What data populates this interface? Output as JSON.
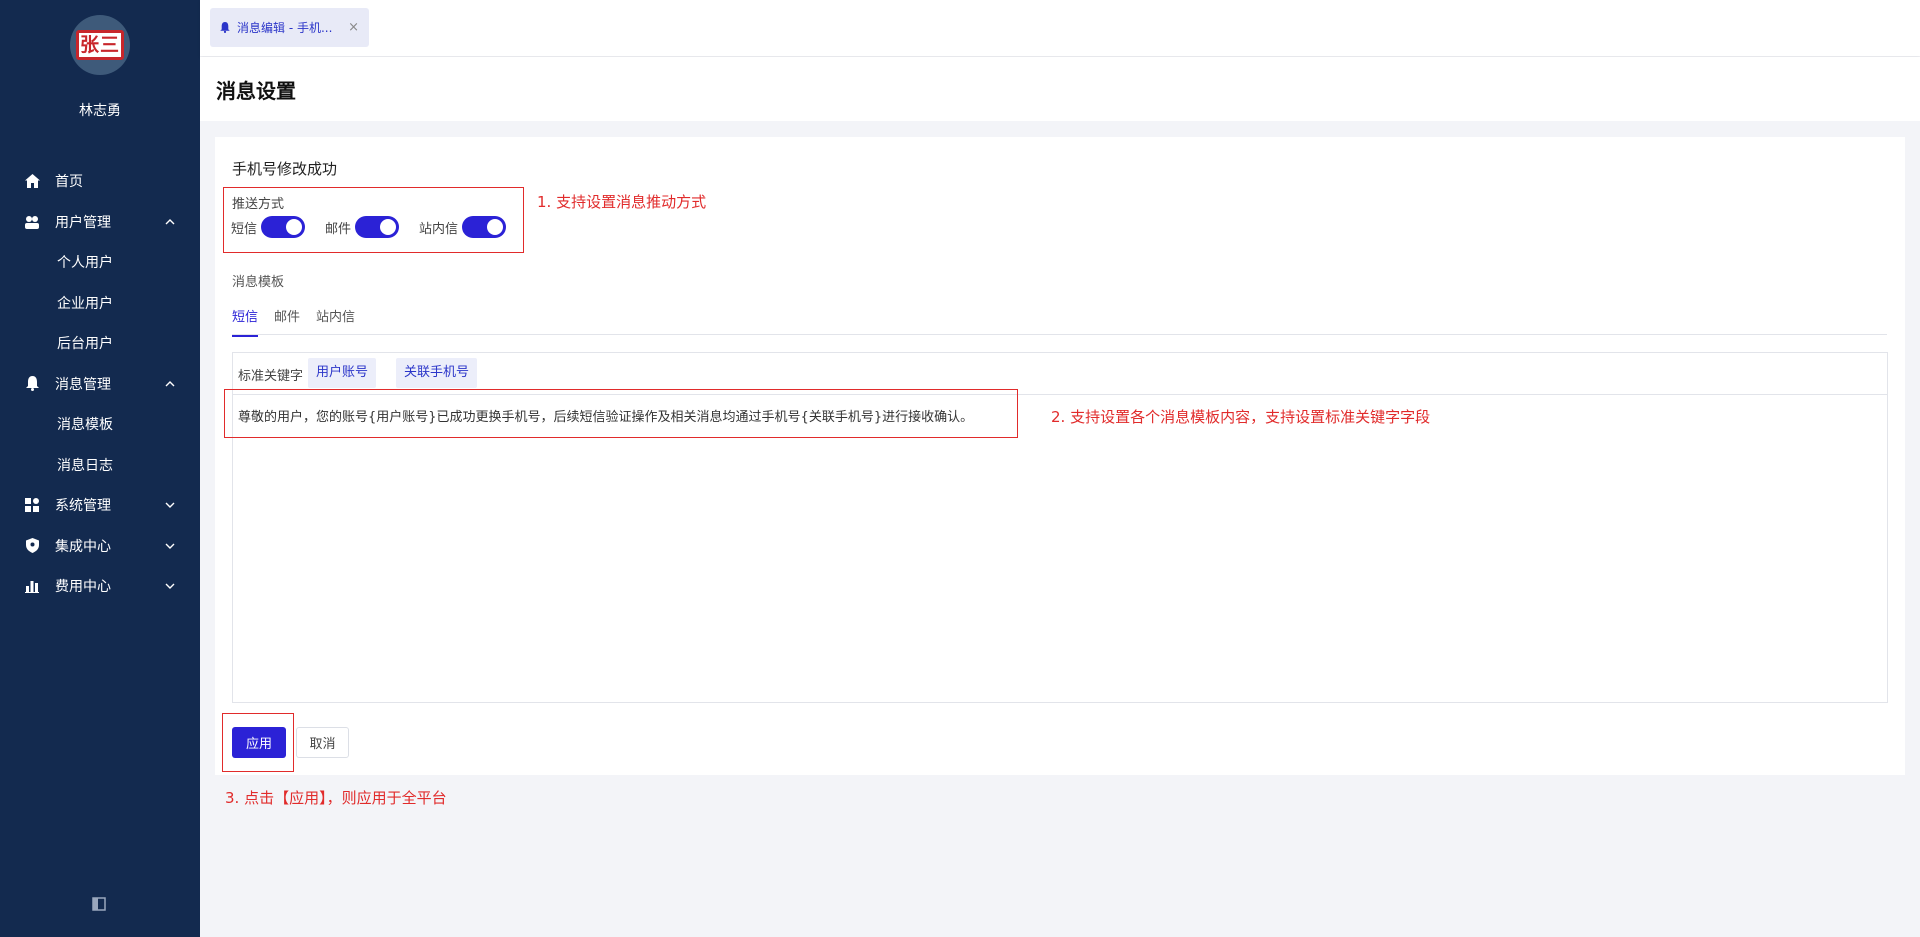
{
  "sidebar": {
    "avatar_text": "张三",
    "username": "林志勇",
    "items": [
      {
        "label": "首页"
      },
      {
        "label": "用户管理"
      },
      {
        "label": "个人用户"
      },
      {
        "label": "企业用户"
      },
      {
        "label": "后台用户"
      },
      {
        "label": "消息管理"
      },
      {
        "label": "消息模板"
      },
      {
        "label": "消息日志"
      },
      {
        "label": "系统管理"
      },
      {
        "label": "集成中心"
      },
      {
        "label": "费用中心"
      }
    ]
  },
  "topbar": {
    "tab_label": "消息编辑 - 手机...",
    "tab_close": "×"
  },
  "page": {
    "title": "消息设置",
    "section_title": "手机号修改成功",
    "push_label": "推送方式",
    "toggles": [
      {
        "label": "短信",
        "on": true
      },
      {
        "label": "邮件",
        "on": true
      },
      {
        "label": "站内信",
        "on": true
      }
    ],
    "template_label": "消息模板",
    "template_tabs": [
      {
        "label": "短信",
        "active": true
      },
      {
        "label": "邮件",
        "active": false
      },
      {
        "label": "站内信",
        "active": false
      }
    ],
    "keywords_label": "标准关键字",
    "keywords": [
      "用户账号",
      "关联手机号"
    ],
    "template_content": "尊敬的用户，您的账号{用户账号}已成功更换手机号，后续短信验证操作及相关消息均通过手机号{关联手机号}进行接收确认。",
    "apply_button": "应用",
    "cancel_button": "取消"
  },
  "annotations": {
    "note1": "1. 支持设置消息推动方式",
    "note2": "2. 支持设置各个消息模板内容，支持设置标准关键字字段",
    "note3": "3. 点击【应用】，则应用于全平台"
  },
  "colors": {
    "sidebar_bg": "#132a4f",
    "accent": "#2b22d6",
    "annotation": "#e12b2b"
  }
}
